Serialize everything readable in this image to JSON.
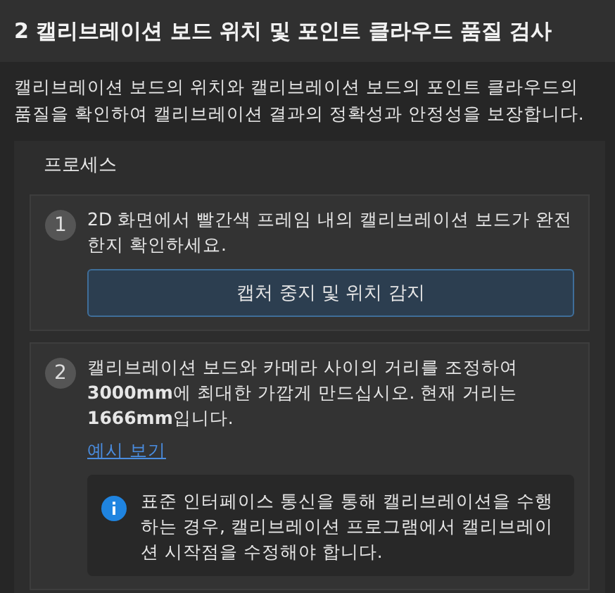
{
  "header": {
    "title": "2 캘리브레이션 보드 위치 및 포인트 클라우드 품질 검사"
  },
  "description": "캘리브레이션 보드의 위치와 캘리브레이션 보드의 포인트 클라우드의 품질을 확인하여 캘리브레이션 결과의 정확성과 안정성을 보장합니다.",
  "process": {
    "title": "프로세스",
    "steps": [
      {
        "number": "1",
        "text": "2D 화면에서 빨간색 프레임 내의 캘리브레이션 보드가 완전한지 확인하세요.",
        "button": "캡처 중지 및 위치 감지"
      },
      {
        "number": "2",
        "text": "캘리브레이션 보드와 카메라 사이의 거리를 조정하여 **3000mm**에 최대한 가깝게 만드십시오. 현재 거리는 **1666mm**입니다.",
        "link": "예시 보기",
        "info": "표준 인터페이스 통신을 통해 캘리브레이션을 수행하는 경우, 캘리브레이션 프로그램에서 캘리브레이션 시작점을 수정해야 합니다."
      }
    ]
  }
}
